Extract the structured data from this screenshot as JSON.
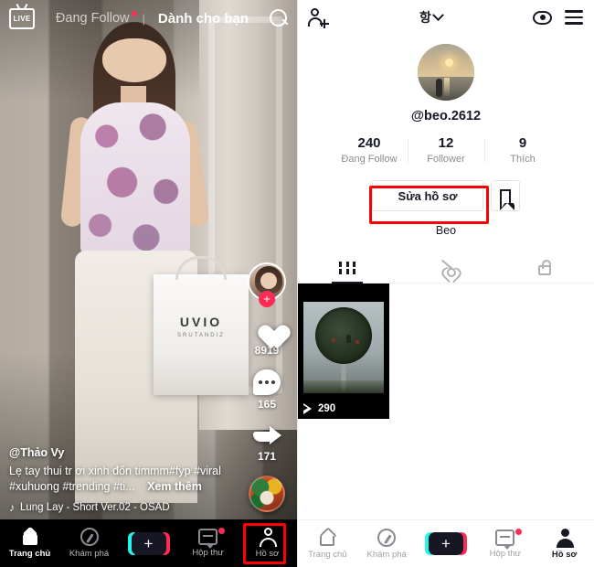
{
  "feed": {
    "live_label": "LIVE",
    "tabs": [
      {
        "label": "Đang Follow",
        "active": false,
        "has_dot": true
      },
      {
        "label": "Dành cho bạn",
        "active": true,
        "has_dot": false
      }
    ],
    "separator": "|",
    "search_icon": "search-icon",
    "rail": {
      "avatar_icon": "creator-avatar",
      "follow_badge": "+",
      "like_count": "8919",
      "comment_count": "165",
      "share_count": "171",
      "music_disc_icon": "music-disc-icon"
    },
    "caption": {
      "username": "@Thảo Vy",
      "line1": "Lẹ tay thui tr ơi xinh đốn timmm#fyp #viral",
      "line2": "#xuhuong #trending #ti...",
      "more_label": "Xem thêm",
      "music_note_icon": "music-note-icon",
      "music": "Lung Lay - Short Ver.02 - OSAD"
    },
    "bag": {
      "brand": "UVIO",
      "sub": "SRUTANDIZ"
    },
    "nav": [
      {
        "label": "Trang chủ",
        "icon": "home-icon",
        "active": true,
        "dot": false
      },
      {
        "label": "Khám phá",
        "icon": "compass-icon",
        "active": false,
        "dot": false
      },
      {
        "label": "+",
        "icon": "create-icon",
        "active": false,
        "dot": false
      },
      {
        "label": "Hộp thư",
        "icon": "inbox-icon",
        "active": false,
        "dot": true
      },
      {
        "label": "Hồ sơ",
        "icon": "profile-icon",
        "active": false,
        "dot": false
      }
    ]
  },
  "profile": {
    "header": {
      "add_user_icon": "add-user-icon",
      "title": "항",
      "chevron_icon": "chevron-down-icon",
      "eye_icon": "eye-icon",
      "menu_icon": "hamburger-menu-icon"
    },
    "avatar_icon": "profile-avatar-sunset",
    "handle": "@beo.2612",
    "stats": [
      {
        "value": "240",
        "label": "Đang Follow"
      },
      {
        "value": "12",
        "label": "Follower"
      },
      {
        "value": "9",
        "label": "Thích"
      }
    ],
    "edit_button": "Sửa hồ sơ",
    "bookmark_icon": "bookmark-icon",
    "bio": "Beo",
    "tabs": [
      {
        "icon": "grid-icon",
        "active": true
      },
      {
        "icon": "hidden-likes-icon",
        "active": false
      },
      {
        "icon": "private-lock-icon",
        "active": false
      }
    ],
    "videos": [
      {
        "views": "290",
        "play_icon": "play-icon"
      }
    ],
    "nav": [
      {
        "label": "Trang chủ",
        "icon": "home-icon",
        "active": false,
        "dot": false
      },
      {
        "label": "Khám phá",
        "icon": "compass-icon",
        "active": false,
        "dot": false
      },
      {
        "label": "+",
        "icon": "create-icon",
        "active": false,
        "dot": false
      },
      {
        "label": "Hộp thư",
        "icon": "inbox-icon",
        "active": false,
        "dot": true
      },
      {
        "label": "Hồ sơ",
        "icon": "profile-icon",
        "active": true,
        "dot": false
      }
    ]
  },
  "highlights": {
    "accent_color": "#ff0000",
    "boxes": [
      "edit-profile-button",
      "profile-nav-item"
    ]
  }
}
